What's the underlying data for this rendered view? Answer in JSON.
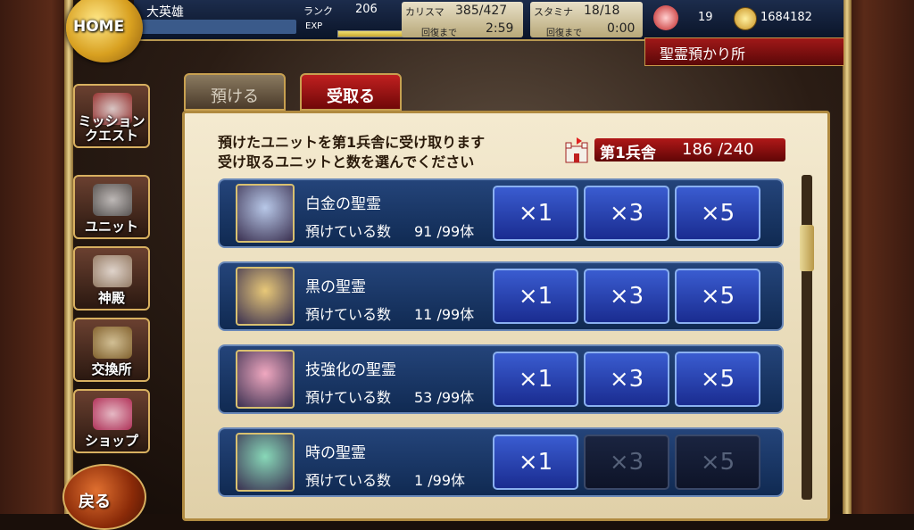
{
  "header": {
    "player_name": "大英雄",
    "rank_label": "ランク",
    "rank_value": "206",
    "exp_label": "EXP",
    "exp_progress": 0.85,
    "charisma_label": "カリスマ",
    "charisma_value": "385/427",
    "charisma_recover_label": "回復まで",
    "charisma_recover_time": "2:59",
    "stamina_label": "スタミナ",
    "stamina_value": "18/18",
    "stamina_recover_label": "回復まで",
    "stamina_recover_time": "0:00",
    "crystal_count": "19",
    "gold_count": "1684182",
    "home_label": "HOME"
  },
  "location": "聖霊預かり所",
  "side_menu": [
    {
      "label": "ミッション\nクエスト",
      "icon": "mission-icon"
    },
    {
      "label": "ユニット",
      "icon": "unit-icon"
    },
    {
      "label": "神殿",
      "icon": "temple-icon"
    },
    {
      "label": "交換所",
      "icon": "exchange-icon"
    },
    {
      "label": "ショップ",
      "icon": "shop-icon"
    }
  ],
  "back_label": "戻る",
  "tabs": {
    "deposit": "預ける",
    "receive": "受取る"
  },
  "instructions": {
    "line1": "預けたユニットを第1兵舎に受け取ります",
    "line2": "受け取るユニットと数を選んでください"
  },
  "barracks": {
    "name": "第1兵舎",
    "capacity": "186 /240"
  },
  "held_label": "預けている数",
  "quantity_buttons": [
    "×1",
    "×3",
    "×5"
  ],
  "spirits": [
    {
      "name": "白金の聖霊",
      "held": "91 /99体",
      "enabled": [
        true,
        true,
        true
      ],
      "color": "#b8c8e8"
    },
    {
      "name": "黒の聖霊",
      "held": "11 /99体",
      "enabled": [
        true,
        true,
        true
      ],
      "color": "#e8c878"
    },
    {
      "name": "技強化の聖霊",
      "held": "53 /99体",
      "enabled": [
        true,
        true,
        true
      ],
      "color": "#f0a8c0"
    },
    {
      "name": "時の聖霊",
      "held": "1 /99体",
      "enabled": [
        true,
        false,
        false
      ],
      "color": "#88d8b8"
    }
  ]
}
